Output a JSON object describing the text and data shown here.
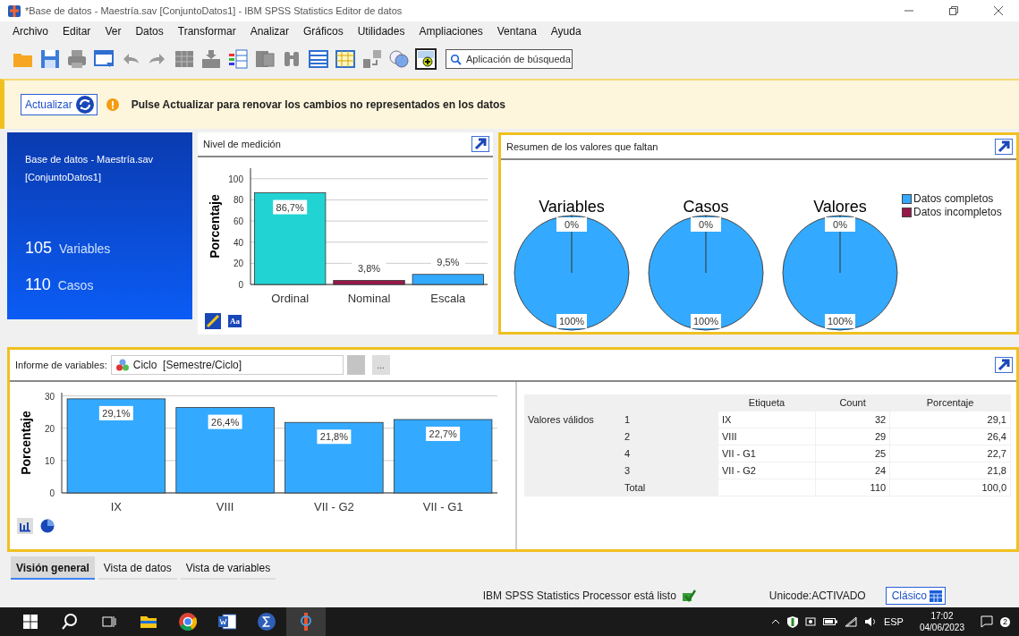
{
  "window": {
    "title": "*Base de datos - Maestría.sav [ConjuntoDatos1] - IBM SPSS Statistics Editor de datos"
  },
  "menu": [
    {
      "label": "Archivo"
    },
    {
      "label": "Editar"
    },
    {
      "label": "Ver"
    },
    {
      "label": "Datos"
    },
    {
      "label": "Transformar"
    },
    {
      "label": "Analizar"
    },
    {
      "label": "Gráficos"
    },
    {
      "label": "Utilidades"
    },
    {
      "label": "Ampliaciones"
    },
    {
      "label": "Ventana"
    },
    {
      "label": "Ayuda"
    }
  ],
  "toolbar": {
    "search_placeholder": "Aplicación de búsqueda"
  },
  "notice": {
    "button": "Actualizar",
    "message": "Pulse Actualizar para renovar los cambios no representados en los datos"
  },
  "dataset_card": {
    "name": "Base de datos - Maestría.sav [ConjuntoDatos1]",
    "stats": [
      {
        "value": "105",
        "label": "Variables"
      },
      {
        "value": "110",
        "label": "Casos"
      }
    ]
  },
  "measurement_panel": {
    "title": "Nivel de medición",
    "text_icon": "Aa",
    "chart_data": {
      "type": "bar",
      "ylabel": "Porcentaje",
      "categories": [
        "Ordinal",
        "Nominal",
        "Escala"
      ],
      "values": [
        86.7,
        3.8,
        9.5
      ],
      "colors": [
        "#22d3d3",
        "#99184a",
        "#33aaff"
      ],
      "ylim": [
        0,
        110
      ],
      "yticks": [
        0,
        20,
        40,
        60,
        80,
        100
      ],
      "grid": true,
      "value_labels": [
        "86,7%",
        "3,8%",
        "9,5%"
      ]
    }
  },
  "missing_panel": {
    "title": "Resumen de los valores que faltan",
    "legend": [
      {
        "label": "Datos completos",
        "color": "#33aaff"
      },
      {
        "label": "Datos incompletos",
        "color": "#99184a"
      }
    ],
    "charts": [
      {
        "chart_data": {
          "type": "pie",
          "title": "Variables",
          "values": [
            100,
            0
          ],
          "value_labels": [
            "100%",
            "0%"
          ]
        }
      },
      {
        "chart_data": {
          "type": "pie",
          "title": "Casos",
          "values": [
            100,
            0
          ],
          "value_labels": [
            "100%",
            "0%"
          ]
        }
      },
      {
        "chart_data": {
          "type": "pie",
          "title": "Valores",
          "values": [
            100,
            0
          ],
          "value_labels": [
            "100%",
            "0%"
          ]
        }
      }
    ]
  },
  "variable_panel": {
    "label": "Informe de variables:",
    "variable": "Ciclo  [Semestre/Ciclo]",
    "more_button": "...",
    "chart_data": {
      "type": "bar",
      "ylabel": "Porcentaje",
      "categories": [
        "IX",
        "VIII",
        "VII - G2",
        "VII - G1"
      ],
      "values": [
        29.1,
        26.4,
        21.8,
        22.7
      ],
      "colors": [
        "#33aaff",
        "#33aaff",
        "#33aaff",
        "#33aaff"
      ],
      "ylim": [
        0,
        31
      ],
      "yticks": [
        0,
        10,
        20,
        30
      ],
      "grid": true,
      "value_labels": [
        "29,1%",
        "26,4%",
        "21,8%",
        "22,7%"
      ]
    },
    "table": {
      "columns": [
        "Etiqueta",
        "Count",
        "Porcentaje"
      ],
      "group": "Valores válidos",
      "rows": [
        {
          "value": "1",
          "label": "IX",
          "count": "32",
          "percent": "29,1"
        },
        {
          "value": "2",
          "label": "VIII",
          "count": "29",
          "percent": "26,4"
        },
        {
          "value": "4",
          "label": "VII - G1",
          "count": "25",
          "percent": "22,7"
        },
        {
          "value": "3",
          "label": "VII - G2",
          "count": "24",
          "percent": "21,8"
        },
        {
          "value": "Total",
          "count": "110",
          "percent": "100,0"
        }
      ]
    }
  },
  "view_tabs": [
    {
      "label": "Visión general",
      "selected": true
    },
    {
      "label": "Vista de datos",
      "selected": false
    },
    {
      "label": "Vista de variables",
      "selected": false
    }
  ],
  "status_bar": {
    "message": "IBM SPSS Statistics Processor está listo",
    "unicode": "Unicode:ACTIVADO",
    "mode_button": "Clásico"
  },
  "taskbar": {
    "language": "ESP",
    "time": "17:02",
    "date": "04/06/2023",
    "notifications": "2"
  }
}
